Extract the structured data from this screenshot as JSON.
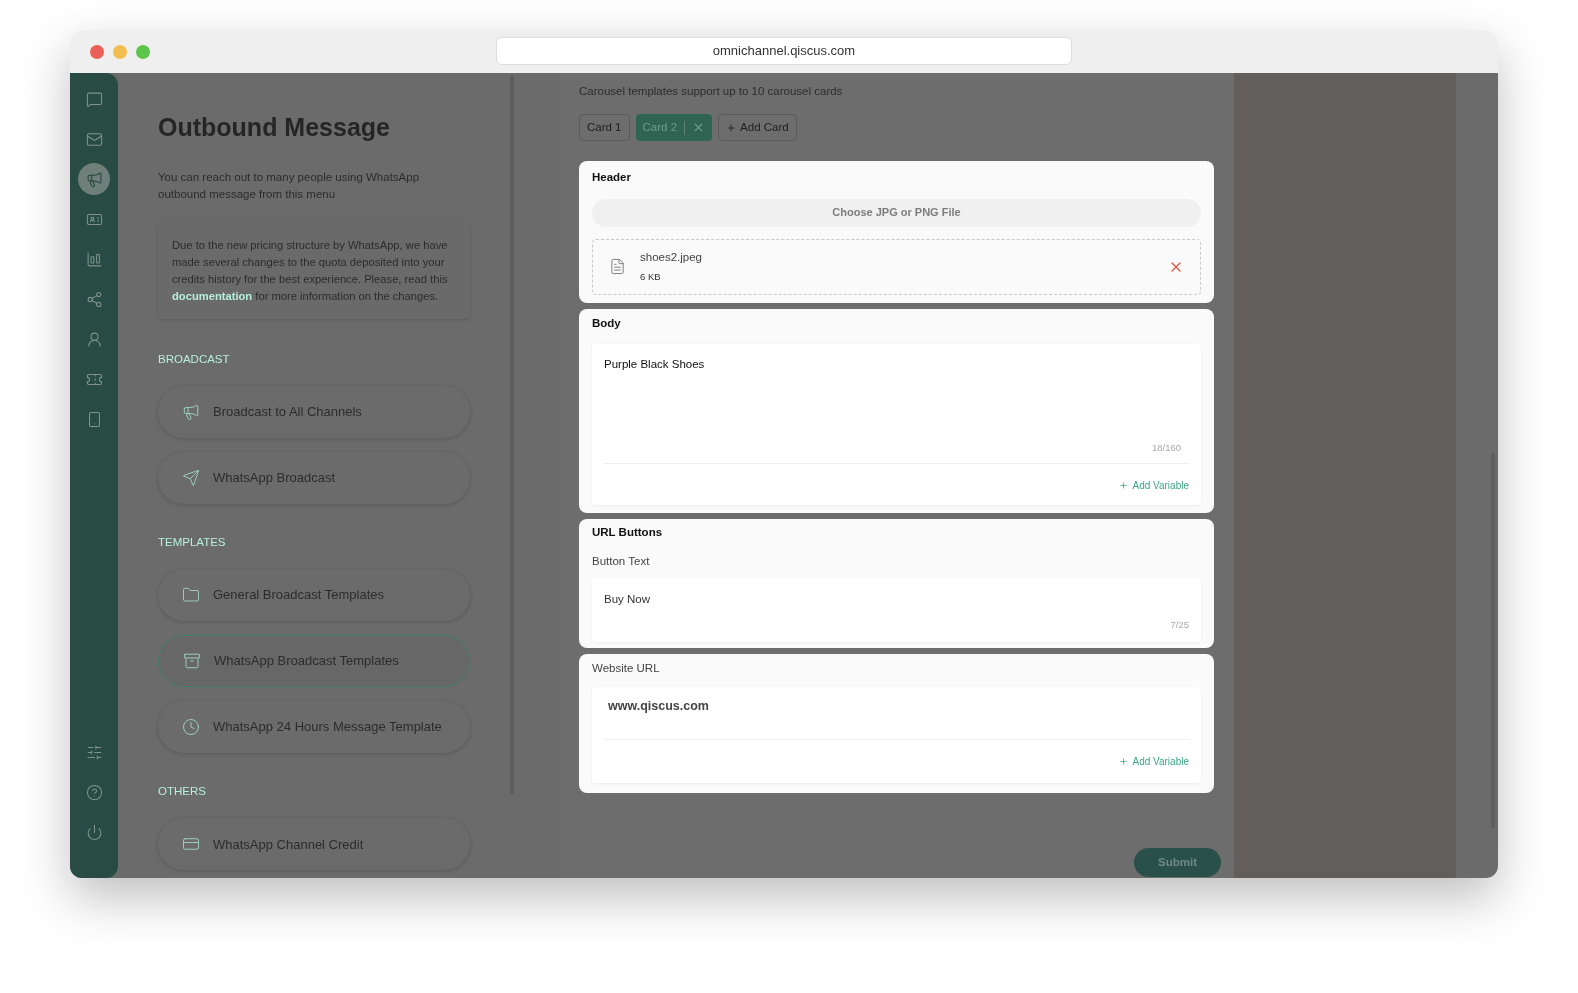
{
  "browser": {
    "url": "omnichannel.qiscus.com"
  },
  "rail": {
    "top": [
      {
        "selected": false
      },
      {
        "selected": false
      },
      {
        "selected": true
      },
      {
        "selected": false
      },
      {
        "selected": false
      },
      {
        "selected": false
      },
      {
        "selected": false
      },
      {
        "selected": false
      },
      {
        "selected": false
      }
    ],
    "bottom": [
      {
        "selected": false
      },
      {
        "selected": false
      },
      {
        "selected": false
      }
    ]
  },
  "panel": {
    "title": "Outbound Message",
    "intro": "You can reach out to many people using WhatsApp outbound message from this menu",
    "notice": {
      "before": "Due to the new pricing structure by WhatsApp, we have made several changes to the quota deposited into your credits history for the best experience. Please, read this",
      "link": "documentation",
      "after": "for more information on the changes."
    },
    "sections": [
      {
        "title": "BROADCAST",
        "items": [
          {
            "label": "Broadcast to All Channels",
            "selected": false
          },
          {
            "label": "WhatsApp Broadcast",
            "selected": false
          }
        ]
      },
      {
        "title": "TEMPLATES",
        "items": [
          {
            "label": "General Broadcast Templates",
            "selected": false
          },
          {
            "label": "WhatsApp Broadcast Templates",
            "selected": true
          },
          {
            "label": "WhatsApp 24 Hours Message Template",
            "selected": false
          }
        ]
      },
      {
        "title": "OTHERS",
        "items": [
          {
            "label": "WhatsApp Channel Credit",
            "selected": false
          }
        ]
      }
    ]
  },
  "carousel": {
    "hint": "Carousel templates support up to 10 carousel cards",
    "tabs": [
      {
        "label": "Card 1",
        "selected": false
      },
      {
        "label": "Card 2",
        "selected": true
      }
    ],
    "add_card": "Add Card",
    "header": {
      "title": "Header",
      "upload": "Choose JPG or PNG File",
      "file": {
        "name": "shoes2.jpeg",
        "size": "6 KB"
      }
    },
    "body": {
      "title": "Body",
      "value": "Purple Black Shoes",
      "count": "18/160",
      "add_variable": "Add Variable"
    },
    "url_buttons": {
      "title": "URL Buttons",
      "button_text_label": "Button Text",
      "button_text": "Buy Now",
      "count": "7/25"
    },
    "website": {
      "label": "Website URL",
      "value": "www.qiscus.com",
      "add_variable": "Add Variable"
    }
  },
  "submit": "Submit"
}
